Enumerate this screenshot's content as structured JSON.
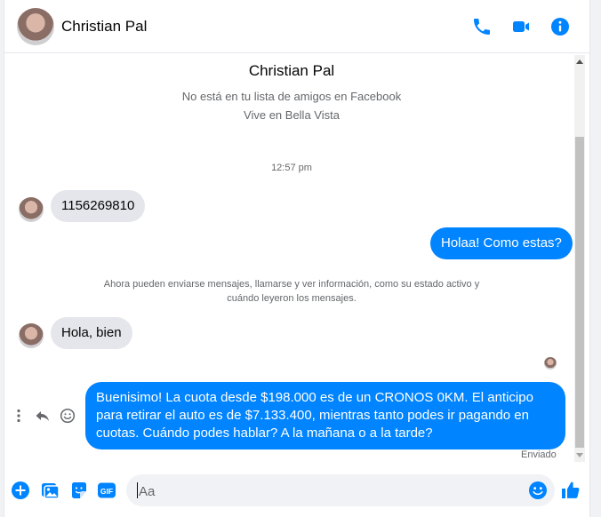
{
  "header": {
    "name": "Christian Pal"
  },
  "profile": {
    "name": "Christian Pal",
    "friend_status": "No está en tu lista de amigos en Facebook",
    "location": "Vive en Bella Vista"
  },
  "messages": {
    "timestamp": "12:57 pm",
    "m1": "1156269810",
    "m2": "Holaa! Como estas?",
    "system": "Ahora pueden enviarse mensajes, llamarse y ver información, como su estado activo y cuándo leyeron los mensajes.",
    "m3": "Hola, bien",
    "m4": "Buenisimo! La cuota desde $198.000 es de un CRONOS 0KM. El anticipo para retirar el auto es de $7.133.400, mientras tanto podes ir pagando en cuotas. Cuándo podes hablar? A la mañana o a la tarde?",
    "status": "Enviado"
  },
  "composer": {
    "placeholder": "Aa",
    "value": ""
  },
  "colors": {
    "accent": "#0084ff",
    "incoming_bubble": "#e4e6eb",
    "muted_text": "#65676b"
  },
  "icons": {
    "header": [
      "phone-icon",
      "video-icon",
      "info-icon"
    ],
    "composer": [
      "plus-icon",
      "image-icon",
      "sticker-icon",
      "gif-icon",
      "emoji-icon",
      "like-icon"
    ],
    "message_actions": [
      "more-icon",
      "reply-icon",
      "react-icon"
    ]
  }
}
